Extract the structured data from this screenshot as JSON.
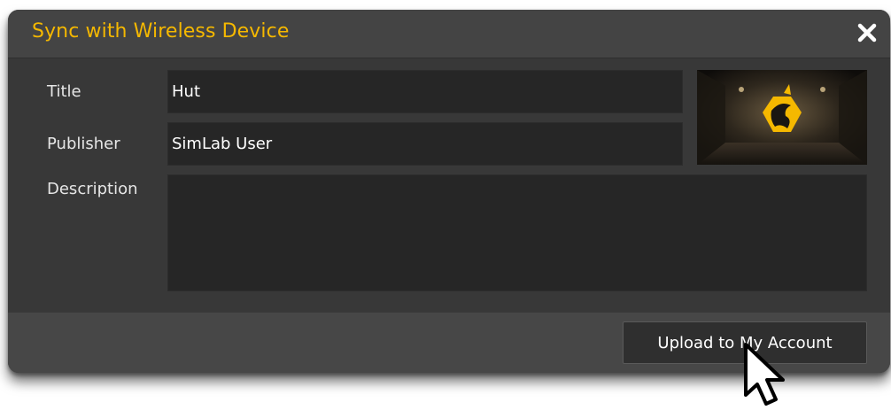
{
  "dialog": {
    "title": "Sync with Wireless Device",
    "close_icon": "close-icon"
  },
  "form": {
    "title_label": "Title",
    "title_value": "Hut",
    "publisher_label": "Publisher",
    "publisher_value": "SimLab User",
    "description_label": "Description",
    "description_value": ""
  },
  "thumbnail": {
    "icon": "dragon-logo-icon"
  },
  "footer": {
    "upload_label": "Upload to My Account"
  },
  "colors": {
    "accent": "#f5b800",
    "dialog_bg": "#383838",
    "field_bg": "#262626"
  },
  "cursor_icon": "mouse-pointer-icon"
}
